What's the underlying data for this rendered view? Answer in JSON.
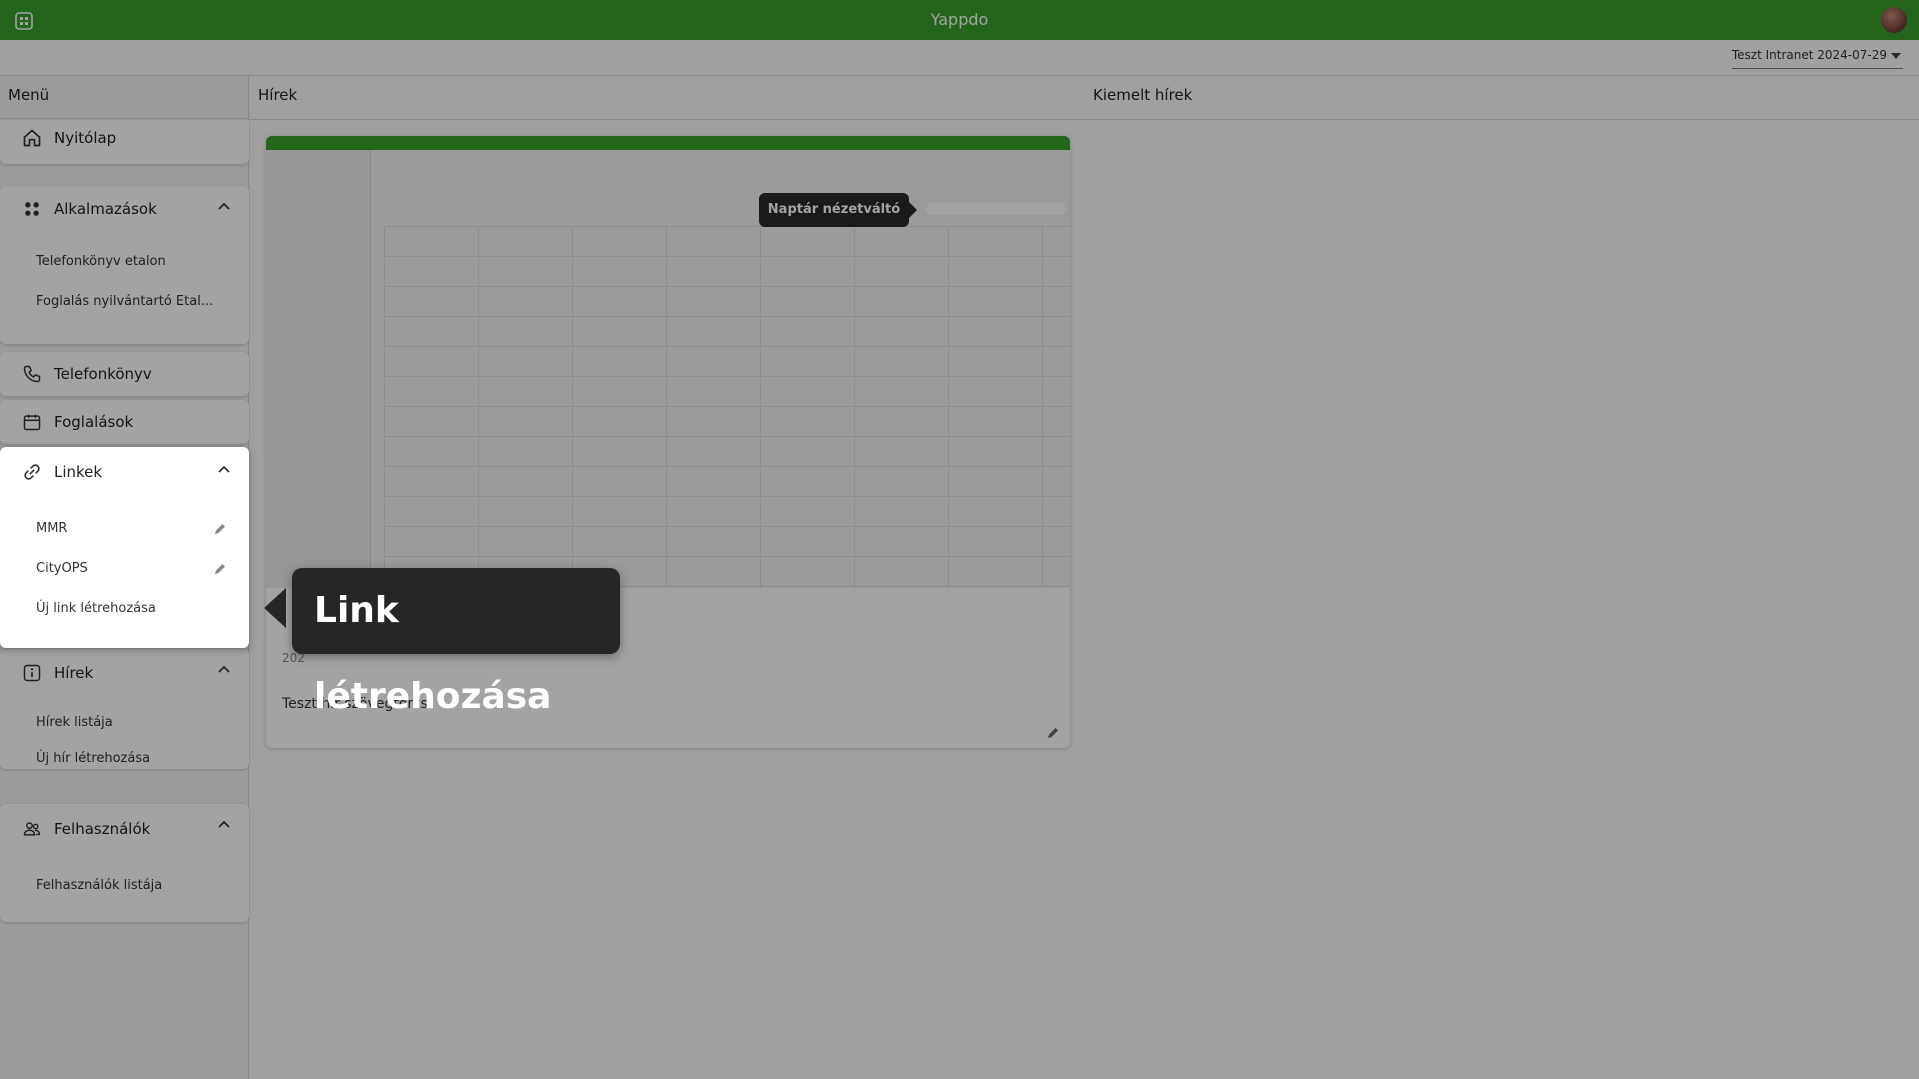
{
  "app": {
    "title": "Yappdo"
  },
  "tenant": {
    "label": "Teszt Intranet 2024-07-29"
  },
  "sidebar": {
    "header": "Menü",
    "home": {
      "label": "Nyitólap"
    },
    "apps": {
      "label": "Alkalmazások",
      "items": [
        "Telefonkönyv etalon",
        "Foglalás nyilvántartó Etal..."
      ]
    },
    "phonebook": {
      "label": "Telefonkönyv"
    },
    "bookings": {
      "label": "Foglalások"
    },
    "links": {
      "label": "Linkek",
      "items": [
        "MMR",
        "CityOPS"
      ],
      "create": "Új link létrehozása"
    },
    "news": {
      "label": "Hírek",
      "items": [
        "Hírek listája",
        "Új hír létrehozása"
      ]
    },
    "users": {
      "label": "Felhasználók",
      "items": [
        "Felhasználók listája"
      ]
    }
  },
  "main": {
    "news_header": "Hírek",
    "featured_header": "Kiemelt hírek",
    "news_card": {
      "image_tooltip": "Naptár nézetváltó",
      "date_fragment": "202",
      "body": "Teszt hír szövegtörzs."
    }
  },
  "tutorial": {
    "tooltip": "Link létrehozása"
  },
  "colors": {
    "brand": "#38a02b",
    "tooltip_bg": "#262626"
  }
}
